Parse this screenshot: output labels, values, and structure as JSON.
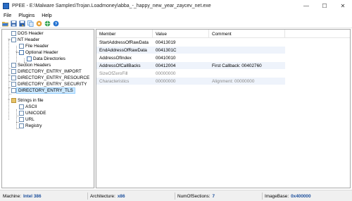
{
  "window": {
    "title": "PPEE - E:\\Malware Samples\\Trojan.Loadmoney\\abba_-_happy_new_year_zaycev_net.exe",
    "controls": {
      "minimize": "—",
      "maximize": "☐",
      "close": "✕"
    }
  },
  "menu": [
    "File",
    "Plugins",
    "Help"
  ],
  "toolbar": [
    {
      "icon": "open-folder-icon",
      "color": "#3a7bd5"
    },
    {
      "icon": "save-icon",
      "color": "#2a5ea8"
    },
    {
      "icon": "save-as-icon",
      "color": "#2a5ea8"
    },
    {
      "icon": "copy-icon",
      "color": "#4a90d9"
    },
    {
      "icon": "settings-icon",
      "color": "#e8a23a"
    },
    {
      "icon": "globe-icon",
      "color": "#3aa856"
    },
    {
      "icon": "help-icon",
      "color": "#1e6fd0"
    }
  ],
  "tree": [
    "DOS Header",
    "NT Header",
    "File Header",
    "Optional Header",
    "Data Directories",
    "Section Headers",
    "DIRECTORY_ENTRY_IMPORT",
    "DIRECTORY_ENTRY_RESOURCE",
    "DIRECTORY_ENTRY_SECURITY",
    "DIRECTORY_ENTRY_TLS",
    "Strings in file",
    "ASCII",
    "UNICODE",
    "URL",
    "Registry"
  ],
  "tree_expanders": {
    "nt_header": "−",
    "optional_header": "−",
    "strings": "−"
  },
  "columns": [
    "Member",
    "Value",
    "Comment"
  ],
  "rows": [
    {
      "member": "StartAddressOfRawData",
      "value": "00413019",
      "comment": "",
      "disabled": false
    },
    {
      "member": "EndAddressOfRawData",
      "value": "0041301C",
      "comment": "",
      "disabled": false
    },
    {
      "member": "AddressOfIndex",
      "value": "00410010",
      "comment": "",
      "disabled": false
    },
    {
      "member": "AddressOfCallBacks",
      "value": "00412004",
      "comment": "First Callback: 00402760",
      "disabled": false
    },
    {
      "member": "SizeOfZeroFill",
      "value": "00000000",
      "comment": "",
      "disabled": true
    },
    {
      "member": "Characteristics",
      "value": "00000000",
      "comment": "Alignment: 00000000",
      "disabled": true
    }
  ],
  "status": {
    "machine_label": "Machine:",
    "machine_value": "Intel 386",
    "arch_label": "Architecture:",
    "arch_value": "x86",
    "sections_label": "NumOfSections:",
    "sections_value": "7",
    "imagebase_label": "ImageBase:",
    "imagebase_value": "0x400000"
  }
}
